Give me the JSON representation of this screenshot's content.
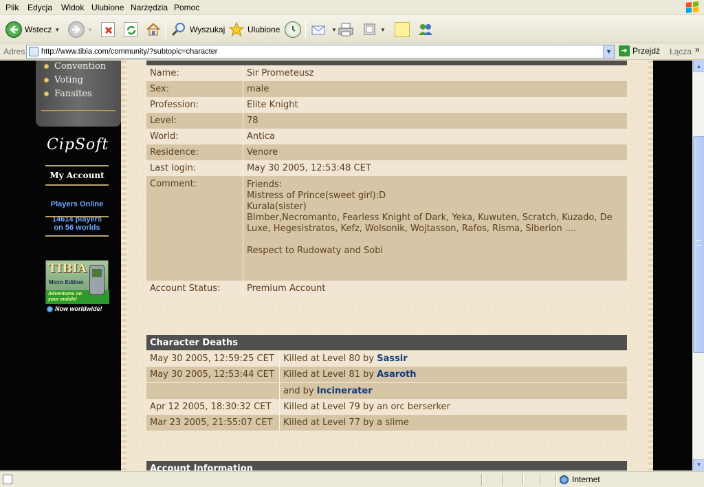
{
  "menu": [
    "Plik",
    "Edycja",
    "Widok",
    "Ulubione",
    "Narzędzia",
    "Pomoc"
  ],
  "toolbar": {
    "back_label": "Wstecz",
    "search_label": "Wyszukaj",
    "favorites_label": "Ulubione"
  },
  "address": {
    "label": "Adres",
    "url": "http://www.tibia.com/community/?subtopic=character",
    "go_label": "Przejdź",
    "links_label": "Łącza",
    "links_more": "»"
  },
  "sidebar": {
    "items": [
      "Convention",
      "Voting",
      "Fansites"
    ],
    "logo": "CipSoft",
    "my_account": "My Account",
    "players_online_title": "Players Online",
    "players_online_line1": "14614 players",
    "players_online_line2": "on 56 worlds",
    "banner_title": "TIBIA",
    "banner_sub": "Micro Edition",
    "banner_strip": "Adventures on your mobile!",
    "worldwide": "Now worldwide!"
  },
  "character": {
    "rows": [
      {
        "label": "Name:",
        "value": "Sir Prometeusz"
      },
      {
        "label": "Sex:",
        "value": "male"
      },
      {
        "label": "Profession:",
        "value": "Elite Knight"
      },
      {
        "label": "Level:",
        "value": "78"
      },
      {
        "label": "World:",
        "value": "Antica"
      },
      {
        "label": "Residence:",
        "value": "Venore"
      },
      {
        "label": "Last login:",
        "value": "May 30 2005, 12:53:48 CET"
      }
    ],
    "comment_label": "Comment:",
    "comment_lines": [
      "Friends:",
      "Mistress of Prince(sweet girl):D",
      "Kurala(sister)",
      "BImber,Necromanto, Fearless Knight of Dark, Yeka, Kuwuten, Scratch, Kuzado, De",
      "Luxe, Hegesistratos, Kefz, Wolsonik, Wojtasson, Rafos, Risma, Siberion ....",
      "",
      "Respect to Rudowaty and Sobi"
    ],
    "account_status_label": "Account Status:",
    "account_status_value": "Premium Account"
  },
  "deaths": {
    "header": "Character Deaths",
    "rows": [
      {
        "date": "May 30 2005, 12:59:25 CET",
        "text": "Killed at Level 80 by ",
        "killer": "Sassir"
      },
      {
        "date": "May 30 2005, 12:53:44 CET",
        "text": "Killed at Level 81 by ",
        "killer": "Asaroth"
      },
      {
        "date": "",
        "text": "and by ",
        "killer": "Incinerater"
      },
      {
        "date": "Apr 12 2005, 18:30:32 CET",
        "text": "Killed at Level 79 by an orc berserker",
        "killer": ""
      },
      {
        "date": "Mar 23 2005, 21:55:07 CET",
        "text": "Killed at Level 77 by a slime",
        "killer": ""
      }
    ]
  },
  "account_info": {
    "header": "Account Information"
  },
  "status": {
    "zone": "Internet"
  }
}
